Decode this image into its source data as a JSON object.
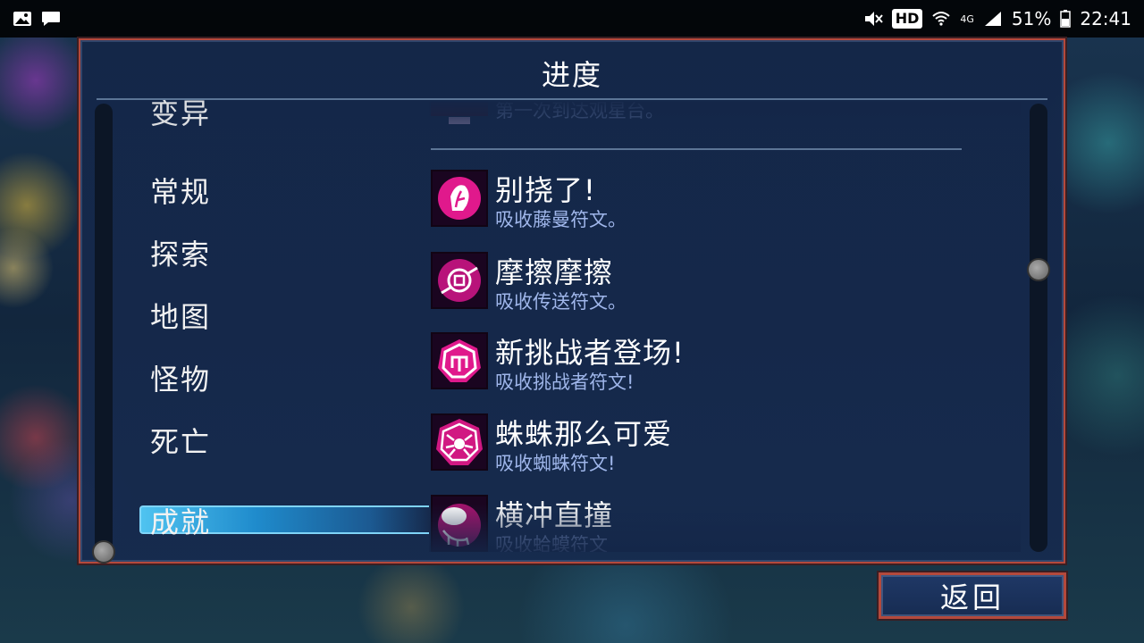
{
  "status_bar": {
    "hd_label": "HD",
    "network": "4G",
    "battery": "51%",
    "time": "22:41"
  },
  "panel": {
    "title": "进度"
  },
  "categories": [
    {
      "label": "变异",
      "state": "partially-visible"
    },
    {
      "label": "常规",
      "state": "normal"
    },
    {
      "label": "探索",
      "state": "normal"
    },
    {
      "label": "地图",
      "state": "normal"
    },
    {
      "label": "怪物",
      "state": "normal"
    },
    {
      "label": "死亡",
      "state": "normal"
    },
    {
      "label": "成就",
      "state": "selected"
    }
  ],
  "achievements": [
    {
      "title": "",
      "desc": "第一次到达观星台。",
      "icon": "observatory-icon",
      "state": "faded"
    },
    {
      "title": "别挠了!",
      "desc": "吸收藤曼符文。",
      "icon": "vine-rune-icon",
      "state": "normal"
    },
    {
      "title": "摩擦摩擦",
      "desc": "吸收传送符文。",
      "icon": "teleport-rune-icon",
      "state": "normal"
    },
    {
      "title": "新挑战者登场!",
      "desc": "吸收挑战者符文!",
      "icon": "challenger-rune-icon",
      "state": "normal"
    },
    {
      "title": "蛛蛛那么可爱",
      "desc": "吸收蜘蛛符文!",
      "icon": "spider-rune-icon",
      "state": "normal"
    },
    {
      "title": "横冲直撞",
      "desc": "吸收蛤蟆符文",
      "icon": "ram-rune-icon",
      "state": "faded"
    }
  ],
  "scroll": {
    "left_position": 1.0,
    "right_position": 0.37
  },
  "back_button": {
    "label": "返回"
  },
  "colors": {
    "panel_border": "#b4493c",
    "selected_bar": "#4fc3f0",
    "desc_text": "#9fb6ea",
    "rune_magenta": "#e0198c"
  }
}
